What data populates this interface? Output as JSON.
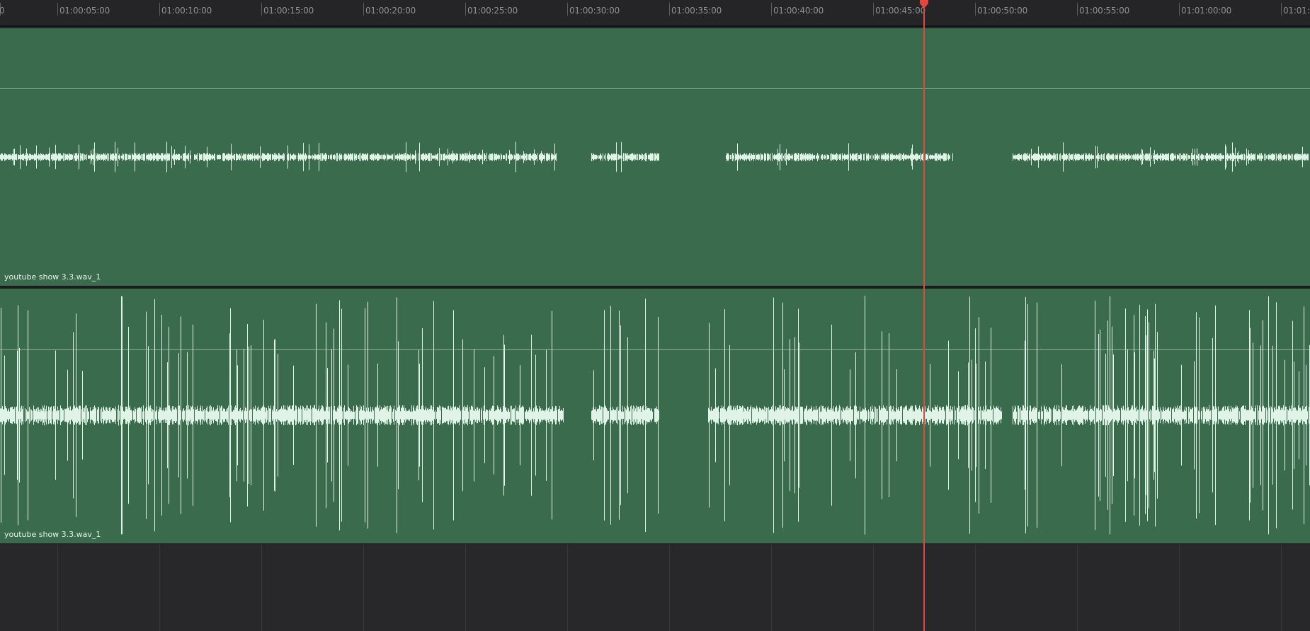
{
  "ruler": {
    "ticks": [
      {
        "label": "0"
      },
      {
        "label": "01:00:05:00"
      },
      {
        "label": "01:00:10:00"
      },
      {
        "label": "01:00:15:00"
      },
      {
        "label": "01:00:20:00"
      },
      {
        "label": "01:00:25:00"
      },
      {
        "label": "01:00:30:00"
      },
      {
        "label": "01:00:35:00"
      },
      {
        "label": "01:00:40:00"
      },
      {
        "label": "01:00:45:00"
      },
      {
        "label": "01:00:50:00"
      },
      {
        "label": "01:00:55:00"
      },
      {
        "label": "01:01:00:00"
      },
      {
        "label": "01:01:0"
      }
    ]
  },
  "tracks": [
    {
      "clip_name": "youtube show 3.3.wav_1"
    },
    {
      "clip_name": "youtube show 3.3.wav_1"
    }
  ],
  "colors": {
    "clip_background": "#3a6b4d",
    "waveform": "#dff3e6",
    "playhead": "#e2473b",
    "ruler_background": "#252528",
    "empty_track_background": "#28282b"
  },
  "icons": {
    "playhead_marker": "playhead-marker-icon"
  }
}
